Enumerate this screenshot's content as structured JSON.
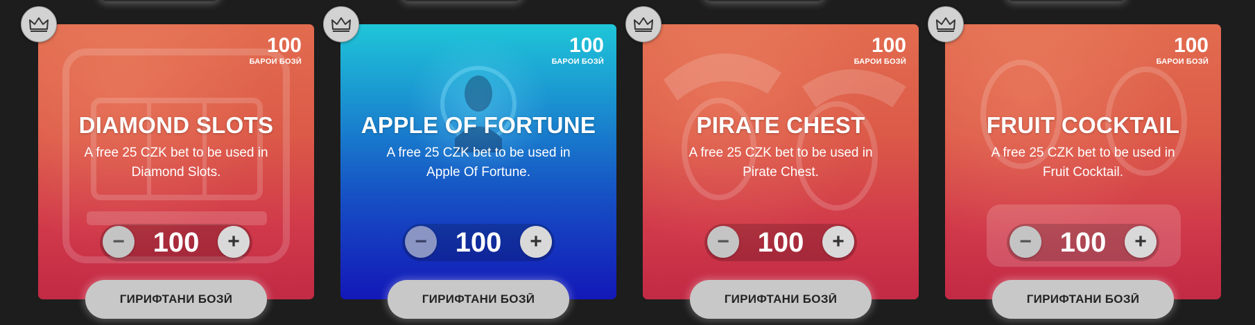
{
  "cards": [
    {
      "theme": "red",
      "title": "DIAMOND SLOTS",
      "description": "A free 25 CZK bet to be used in Diamond Slots.",
      "points_value": "100",
      "points_label": "БАРОИ БОЗӢ",
      "stepper_value": "100",
      "stepper_minus": "−",
      "stepper_plus": "+",
      "claim_label": "ГИРИФТАНИ БОЗӢ",
      "badge_icon": "crown-icon"
    },
    {
      "theme": "blue",
      "title": "APPLE OF FORTUNE",
      "description": "A free 25 CZK bet to be used in Apple Of Fortune.",
      "points_value": "100",
      "points_label": "БАРОИ БОЗӢ",
      "stepper_value": "100",
      "stepper_minus": "−",
      "stepper_plus": "+",
      "claim_label": "ГИРИФТАНИ БОЗӢ",
      "badge_icon": "crown-icon"
    },
    {
      "theme": "red",
      "title": "PIRATE CHEST",
      "description": "A free 25 CZK bet to be used in Pirate Chest.",
      "points_value": "100",
      "points_label": "БАРОИ БОЗӢ",
      "stepper_value": "100",
      "stepper_minus": "−",
      "stepper_plus": "+",
      "claim_label": "ГИРИФТАНИ БОЗӢ",
      "badge_icon": "crown-icon"
    },
    {
      "theme": "red",
      "title": "FRUIT COCKTAIL",
      "description": "A free 25 CZK bet to be used in Fruit Cocktail.",
      "points_value": "100",
      "points_label": "БАРОИ БОЗӢ",
      "stepper_value": "100",
      "stepper_minus": "−",
      "stepper_plus": "+",
      "claim_label": "ГИРИФТАНИ БОЗӢ",
      "badge_icon": "crown-icon"
    }
  ],
  "colors": {
    "page_background": "#1d1d1d",
    "red_card_top": "#e26c4f",
    "red_card_bottom": "#c22a45",
    "blue_card_top": "#1fc6d8",
    "blue_card_bottom": "#1318b8",
    "button_grey": "#c8c8c8"
  }
}
